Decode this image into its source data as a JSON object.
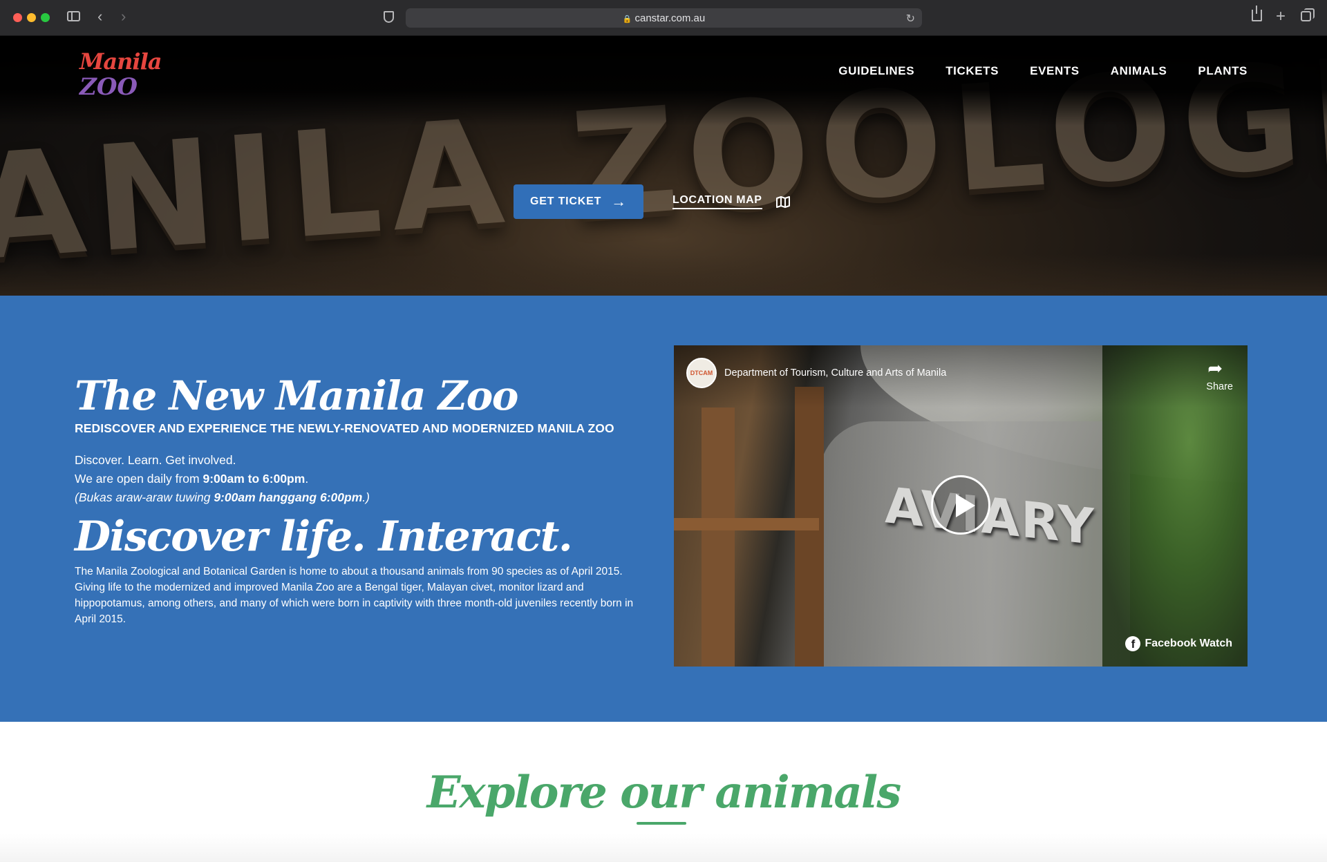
{
  "browser": {
    "url": "canstar.com.au",
    "icons": {
      "sidebar": "sidebar-icon",
      "back": "chevron-left-icon",
      "forward": "chevron-right-icon",
      "privacy": "shield-icon",
      "lock": "lock-icon",
      "reload": "reload-icon",
      "share": "share-icon",
      "new_tab": "plus-icon",
      "tabs": "tabs-icon"
    }
  },
  "header": {
    "logo": {
      "line1": "Manila",
      "line2": "ZOO"
    },
    "nav": [
      "GUIDELINES",
      "TICKETS",
      "EVENTS",
      "ANIMALS",
      "PLANTS"
    ]
  },
  "hero": {
    "sign_text": "ANILA ZOOLOGICA",
    "get_ticket_label": "GET TICKET",
    "location_map_label": "LOCATION MAP",
    "icons": {
      "arrow": "arrow-right-icon",
      "map": "map-icon"
    }
  },
  "info": {
    "title": "The New Manila Zoo",
    "subtitle": "REDISCOVER AND EXPERIENCE THE NEWLY-RENOVATED AND MODERNIZED MANILA ZOO",
    "line1": "Discover. Learn. Get involved.",
    "line2_pre": "We are open daily from ",
    "line2_bold": "9:00am to 6:00pm",
    "line2_post": ".",
    "line3_pre": "(Bukas araw-araw tuwing ",
    "line3_bold": "9:00am hanggang 6:00pm",
    "line3_post": ".)",
    "heading2": "Discover life. Interact.",
    "paragraph": "The Manila Zoological and Botanical Garden is home to about a thousand animals from 90 species as of April 2015. Giving life to the modernized and improved Manila Zoo are a Bengal tiger, Malayan civet, monitor lizard and hippopotamus, among others, and many of which were born in captivity with three month-old juveniles recently born in April 2015."
  },
  "video": {
    "channel": "Department of Tourism, Culture and Arts of Manila",
    "avatar_text": "DTCAM",
    "share_label": "Share",
    "sign_text": "AVIARY",
    "brand": "Facebook Watch",
    "icons": {
      "share": "share-arrow-icon",
      "play": "play-icon",
      "facebook": "facebook-icon"
    }
  },
  "explore": {
    "title": "Explore our animals"
  },
  "colors": {
    "nav_bg": "#000000",
    "primary_blue": "#3571b7",
    "button_blue": "#316fb8",
    "explore_green": "#4aa76a"
  }
}
